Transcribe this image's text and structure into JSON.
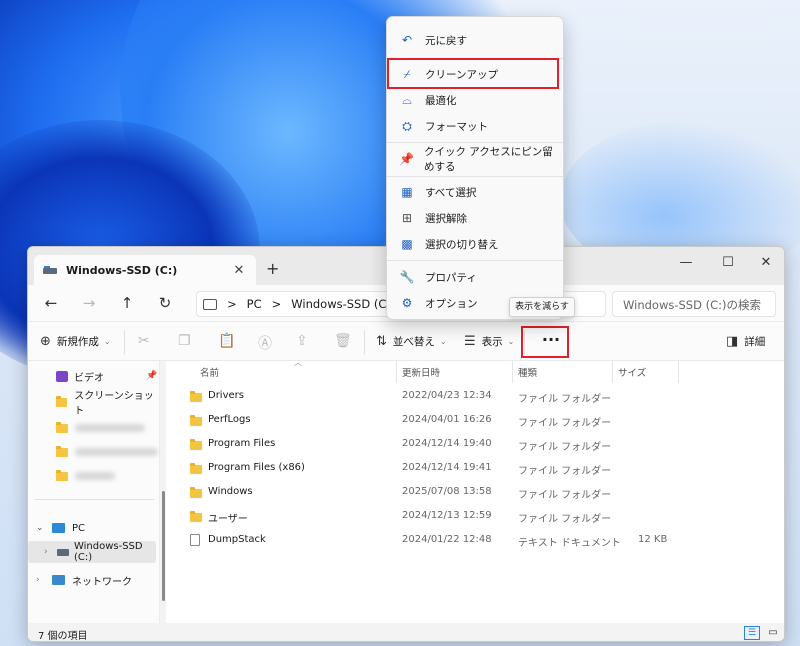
{
  "window": {
    "tab_title": "Windows-SSD (C:)",
    "tab_close": "✕",
    "tab_add": "+",
    "minimize": "—",
    "maximize": "☐",
    "close": "✕"
  },
  "address": {
    "back": "←",
    "forward": "→",
    "up": "↑",
    "refresh": "↻",
    "crumbs": [
      "PC",
      "Windows-SSD (C:)"
    ],
    "separator": ">",
    "search_placeholder": "Windows-SSD (C:)の検索"
  },
  "toolbar": {
    "new_label": "新規作成",
    "sort_label": "並べ替え",
    "view_label": "表示",
    "more_label": "···",
    "details_label": "詳細",
    "tooltip": "表示を減らす"
  },
  "sidebar": {
    "items": [
      {
        "label": "ビデオ"
      },
      {
        "label": "スクリーンショット"
      },
      {
        "label": "PC"
      },
      {
        "label": "Windows-SSD (C:)"
      },
      {
        "label": "ネットワーク"
      }
    ]
  },
  "columns": {
    "name": "名前",
    "modified": "更新日時",
    "type": "種類",
    "size": "サイズ"
  },
  "files": [
    {
      "name": "Drivers",
      "modified": "2022/04/23 12:34",
      "type": "ファイル フォルダー",
      "size": ""
    },
    {
      "name": "PerfLogs",
      "modified": "2024/04/01 16:26",
      "type": "ファイル フォルダー",
      "size": ""
    },
    {
      "name": "Program Files",
      "modified": "2024/12/14 19:40",
      "type": "ファイル フォルダー",
      "size": ""
    },
    {
      "name": "Program Files (x86)",
      "modified": "2024/12/14 19:41",
      "type": "ファイル フォルダー",
      "size": ""
    },
    {
      "name": "Windows",
      "modified": "2025/07/08 13:58",
      "type": "ファイル フォルダー",
      "size": ""
    },
    {
      "name": "ユーザー",
      "modified": "2024/12/13 12:59",
      "type": "ファイル フォルダー",
      "size": ""
    },
    {
      "name": "DumpStack",
      "modified": "2024/01/22 12:48",
      "type": "テキスト ドキュメント",
      "size": "12 KB"
    }
  ],
  "status": {
    "item_count": "7 個の項目"
  },
  "menu": {
    "items": [
      {
        "label": "元に戻す",
        "icon": "undo-icon"
      },
      {
        "label": "クリーンアップ",
        "icon": "broom-icon"
      },
      {
        "label": "最適化",
        "icon": "drive-optimize-icon"
      },
      {
        "label": "フォーマット",
        "icon": "format-icon"
      },
      {
        "label": "クイック アクセスにピン留めする",
        "icon": "pin-icon"
      },
      {
        "label": "すべて選択",
        "icon": "select-all-icon"
      },
      {
        "label": "選択解除",
        "icon": "select-none-icon"
      },
      {
        "label": "選択の切り替え",
        "icon": "invert-selection-icon"
      },
      {
        "label": "プロパティ",
        "icon": "wrench-icon"
      },
      {
        "label": "オプション",
        "icon": "gear-icon"
      }
    ]
  },
  "colors": {
    "accent": "#1f5fbf",
    "highlight_border": "#e0202a"
  }
}
